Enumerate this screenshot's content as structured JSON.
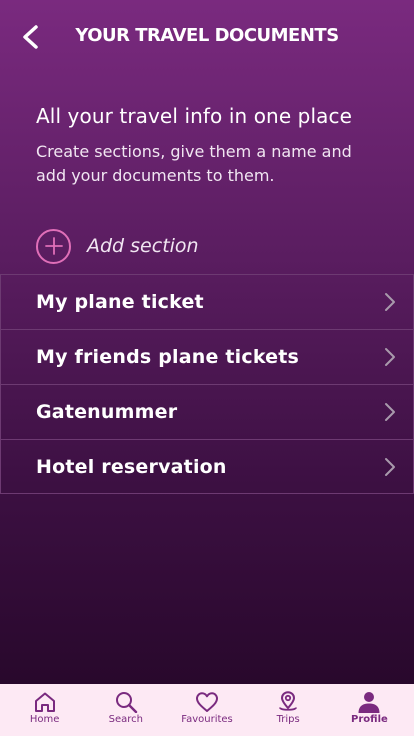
{
  "header": {
    "title": "YOUR TRAVEL DOCUMENTS",
    "back_icon": "chevron-left-icon"
  },
  "intro": {
    "heading": "All your travel info in one place",
    "text": "Create sections, give them a name and add your documents to them."
  },
  "add_section": {
    "label": "Add section",
    "icon": "plus-circle-icon"
  },
  "sections": [
    {
      "label": "My plane ticket"
    },
    {
      "label": "My friends plane tickets"
    },
    {
      "label": "Gatenummer"
    },
    {
      "label": "Hotel reservation"
    }
  ],
  "tabbar": {
    "items": [
      {
        "label": "Home",
        "icon": "home-icon"
      },
      {
        "label": "Search",
        "icon": "search-icon"
      },
      {
        "label": "Favourites",
        "icon": "heart-icon"
      },
      {
        "label": "Trips",
        "icon": "map-pin-icon"
      },
      {
        "label": "Profile",
        "icon": "user-icon",
        "active": true
      }
    ]
  },
  "colors": {
    "accent": "#e06fb8",
    "brand": "#7a2a7f",
    "tabbar_bg": "#fde9f4"
  }
}
